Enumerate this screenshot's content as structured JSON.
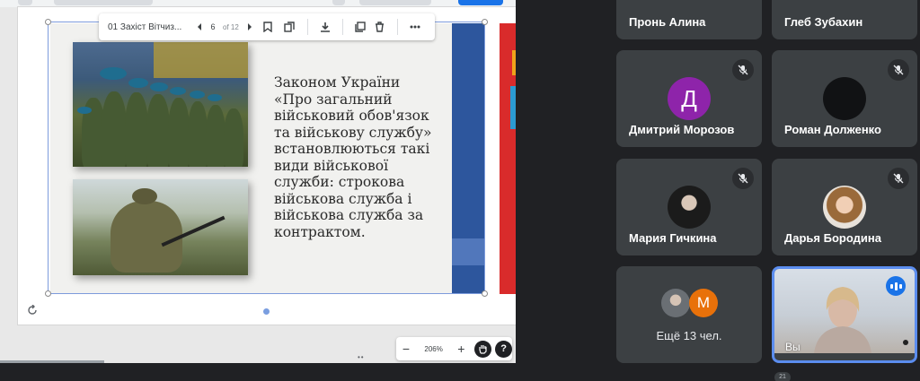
{
  "presentation": {
    "toolbar": {
      "title": "01 Захіст Вітчиз...",
      "current_page": "6",
      "page_total": "of 12"
    },
    "slide": {
      "text": "Законом України\n«Про загальний\nвійськовий обов'язок\nта військову службу»\nвстановлюються такі\nвиди військової\nслужби: строкова\nвійськова служба і\nвійськова служба за\nконтрактом."
    },
    "zoom": {
      "minus": "−",
      "value": "206%",
      "plus": "+",
      "help": "?"
    }
  },
  "participants": [
    {
      "name": "Пронь Алина"
    },
    {
      "name": "Глеб Зубахин"
    },
    {
      "name": "Дмитрий Морозов",
      "initial": "Д",
      "color": "#8e24aa",
      "muted": true
    },
    {
      "name": "Роман Долженко",
      "muted": true
    },
    {
      "name": "Мария Гичкина",
      "muted": true
    },
    {
      "name": "Дарья Бородина",
      "muted": true
    }
  ],
  "more_participants": {
    "initial": "М",
    "color": "#e8710a",
    "label": "Ещё 13 чел."
  },
  "self_tile": {
    "name": "Вы"
  },
  "bottom_badge": "21",
  "colors": {
    "background": "#202124",
    "tile": "#3c4043",
    "accent": "#1a73e8",
    "speaking_border": "#5b8def"
  }
}
